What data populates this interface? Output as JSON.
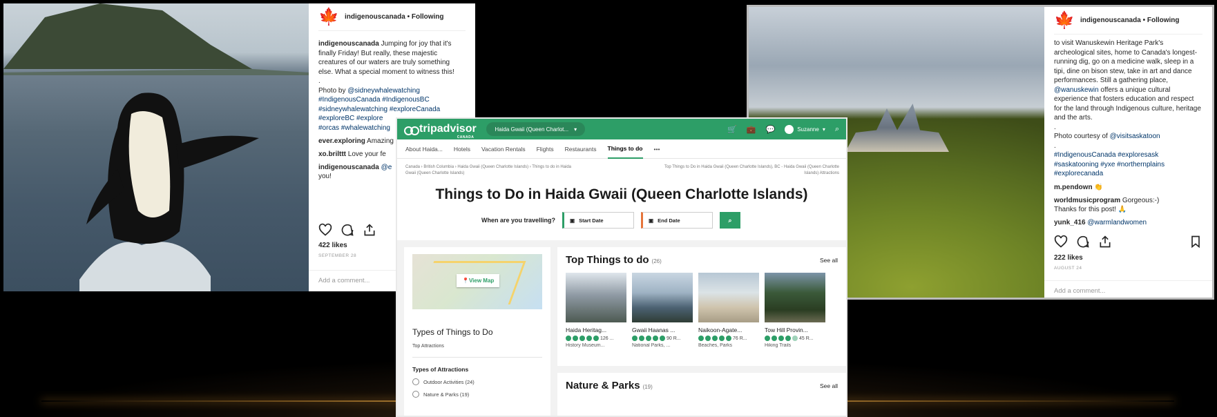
{
  "post1": {
    "user": "indigenouscanada • Following",
    "caption_user": "indigenouscanada",
    "caption": "Jumping for joy that it's finally Friday! But really, these majestic creatures of our waters are truly something else. What a special moment to witness this!",
    "dot": ".",
    "photo_by_prefix": "Photo by ",
    "photo_by_handle": "@sidneywhalewatching",
    "tags_line1": "#IndigenousCanada #IndigenousBC",
    "tags_line2": "#sidneywhalewatching #exploreCanada",
    "tags_line3": "#exploreBC #explore",
    "tags_line4": "#orcas #whalewatching",
    "comment1_user": "ever.exploring",
    "comment1_text": " Amazing",
    "comment2_user": "xo.brilttt",
    "comment2_text": " Love your fe",
    "comment3_user": "indigenouscanada",
    "comment3_text": " @e",
    "comment3_more": "you!",
    "likes": "422 likes",
    "date": "SEPTEMBER 28",
    "add_comment": "Add a comment..."
  },
  "post2": {
    "user": "indigenouscanada • Following",
    "caption": "to visit Wanuskewin Heritage Park's archeological sites, home to Canada's longest-running dig, go on a medicine walk, sleep in a tipi, dine on bison stew, take in art and dance performances. Still a gathering place,",
    "handle1": "@wanuskewin",
    "caption2": " offers a unique cultural experience that fosters education and respect for the land through Indigenous culture, heritage and the arts.",
    "dot": ".",
    "photo_courtesy_prefix": "Photo courtesy of ",
    "photo_courtesy_handle": "@visitsaskatoon",
    "dot2": ".",
    "tags_line1": "#IndigenousCanada #exploresask",
    "tags_line2": "#saskatooning #yxe #northernplains",
    "tags_line3": "#explorecanada",
    "comment1_user": "m.pendown",
    "comment1_text": " 👏",
    "comment2_user": "worldmusicprogram",
    "comment2_text": " Gorgeous:-)",
    "comment2_more": "Thanks for this post! 🙏",
    "comment3_user": "yunk_416",
    "comment3_text": " @warmlandwomen",
    "likes": "222 likes",
    "date": "AUGUST 24",
    "add_comment": "Add a comment..."
  },
  "ta": {
    "logo": "tripadvisor",
    "country": "CANADA",
    "location": "Haida Gwaii (Queen Charlot...",
    "user": "Suzanne",
    "nav": [
      "About Haida...",
      "Hotels",
      "Vacation Rentals",
      "Flights",
      "Restaurants",
      "Things to do",
      "•••"
    ],
    "crumbs": "Canada › British Columbia › Haida Gwaii (Queen Charlotte Islands) › Things to do in Haida Gwaii (Queen Charlotte Islands)",
    "crumbs_right": "Top Things to Do in Haida Gwaii (Queen Charlotte Islands), BC - Haida Gwaii (Queen Charlotte Islands) Attractions",
    "title": "Things to Do in Haida Gwaii (Queen Charlotte Islands)",
    "when_label": "When are you travelling?",
    "start_date": "Start Date",
    "end_date": "End Date",
    "view_map": "View Map",
    "types_title": "Types of Things to Do",
    "top_attractions": "Top Attractions",
    "types_attr_head": "Types of Attractions",
    "radio1": "Outdoor Activities (24)",
    "radio2": "Nature & Parks (19)",
    "top_title": "Top Things to do",
    "top_count": "(26)",
    "see_all": "See all",
    "cards": [
      {
        "name": "Haida Heritag...",
        "reviews": "126 ...",
        "cat": "History Museum..."
      },
      {
        "name": "Gwaii Haanas ...",
        "reviews": "90 R...",
        "cat": "National Parks, ..."
      },
      {
        "name": "Naikoon-Agate...",
        "reviews": "76 R...",
        "cat": "Beaches, Parks"
      },
      {
        "name": "Tow Hill Provin...",
        "reviews": "45 R...",
        "cat": "Hiking Trails"
      }
    ],
    "nature_title": "Nature & Parks",
    "nature_count": "(19)"
  },
  "colors": {
    "ta_green": "#2d9e67",
    "ig_red": "#c0182b",
    "link_blue": "#003569"
  }
}
